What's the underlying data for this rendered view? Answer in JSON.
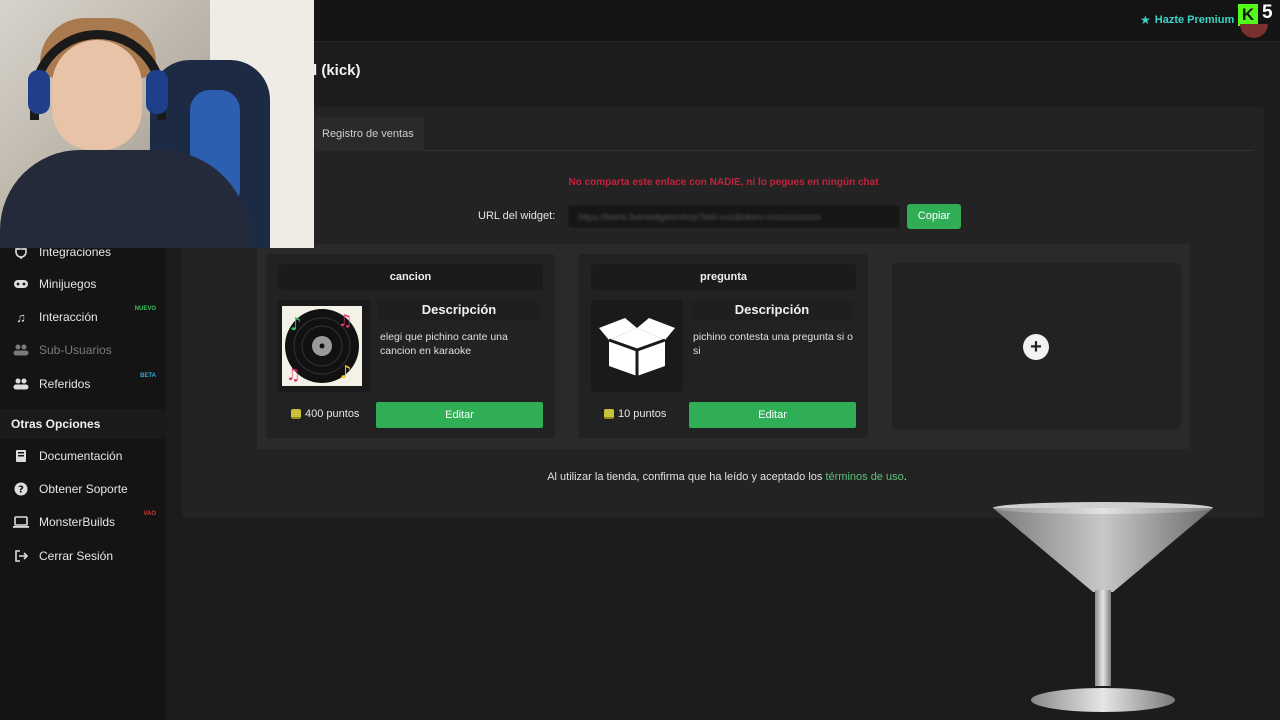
{
  "topbar": {
    "premium_label": "Hazte Premium",
    "kick_count": "5"
  },
  "sidebar": {
    "items": [
      {
        "label": "Integraciones",
        "icon": "plug-icon"
      },
      {
        "label": "Minijuegos",
        "icon": "gamepad-icon"
      },
      {
        "label": "Interacción",
        "icon": "music-icon",
        "tag": "NUEVO"
      },
      {
        "label": "Sub-Usuarios",
        "icon": "users-icon"
      },
      {
        "label": "Referidos",
        "icon": "users-icon",
        "tag": "BETA"
      }
    ],
    "section_title": "Otras Opciones",
    "other_items": [
      {
        "label": "Documentación",
        "icon": "book-icon"
      },
      {
        "label": "Obtener Soporte",
        "icon": "help-icon"
      },
      {
        "label": "MonsterBuilds",
        "icon": "laptop-icon",
        "tag": "VAO"
      },
      {
        "label": "Cerrar Sesión",
        "icon": "logout-icon"
      }
    ]
  },
  "main": {
    "page_title": "d (kick)",
    "tab_sales": "Registro de ventas",
    "warning": "No comparta este enlace con NADIE, ni lo pegues en ningún chat",
    "url_label": "URL del widget:",
    "url_value": "https://botrix.live/widgets/shop?bid=xxx&token=xxxxxxxxxxxx",
    "copy_label": "Copiar",
    "cards": [
      {
        "title": "cancion",
        "desc_title": "Descripción",
        "description": "elegi que pichino cante una cancion en karaoke",
        "price": "400 puntos",
        "edit_label": "Editar"
      },
      {
        "title": "pregunta",
        "desc_title": "Descripción",
        "description": "pichino contesta una pregunta si o si",
        "price": "10 puntos",
        "edit_label": "Editar"
      }
    ],
    "terms_prefix": "Al utilizar la tienda, confirma que ha leído y aceptado los",
    "terms_link": "términos de uso",
    "terms_suffix": "."
  },
  "colors": {
    "accent_green": "#2fae56",
    "warning_red": "#c0243c",
    "premium_teal": "#3ad6c8",
    "kick_green": "#53fc18"
  }
}
